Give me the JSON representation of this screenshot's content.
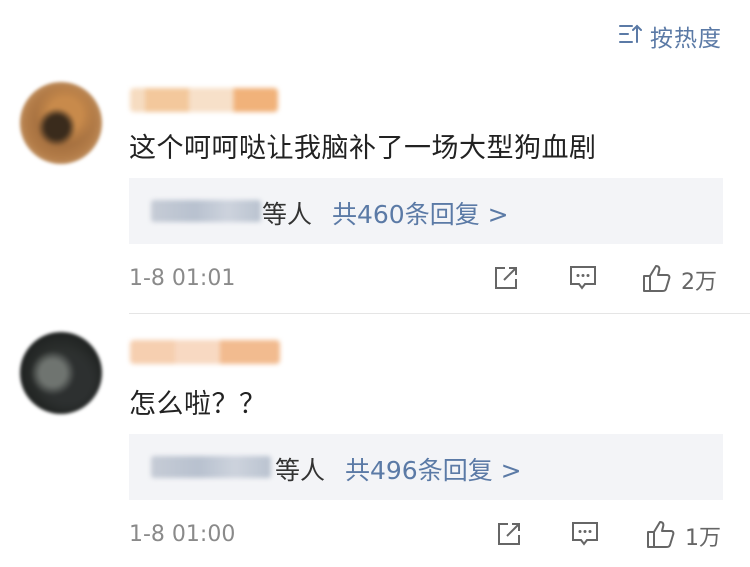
{
  "sort": {
    "label": "按热度",
    "icon": "sort-lines-icon"
  },
  "comments": [
    {
      "text": "这个呵呵哒让我脑补了一场大型狗血剧",
      "reply_who": "等人",
      "reply_count": "共460条回复 >",
      "time": "1-8 01:01",
      "likes": "2万"
    },
    {
      "text": "怎么啦？？",
      "reply_who": "等人",
      "reply_count": "共496条回复 >",
      "time": "1-8 01:00",
      "likes": "1万"
    }
  ],
  "colors": {
    "link": "#5b7aa6",
    "reply_bg": "#f3f4f7",
    "time": "#8a8a8a"
  }
}
